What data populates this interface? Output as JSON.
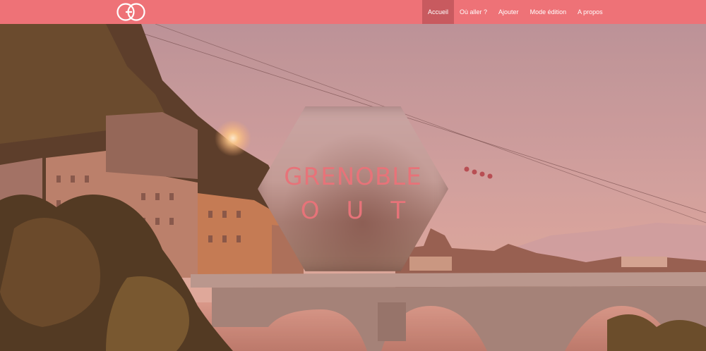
{
  "brand": {
    "logo_text": "GO"
  },
  "nav": {
    "items": [
      {
        "label": "Accueil",
        "active": true
      },
      {
        "label": "Où aller ?",
        "active": false
      },
      {
        "label": "Ajouter",
        "active": false
      },
      {
        "label": "Mode édition",
        "active": false
      },
      {
        "label": "A propos",
        "active": false
      }
    ]
  },
  "hero": {
    "title_line1": "GRENOBLE",
    "title_line2": "OUT"
  },
  "colors": {
    "navbar": "#ee7277",
    "nav_active": "#c85a5f",
    "title": "#e77379"
  }
}
